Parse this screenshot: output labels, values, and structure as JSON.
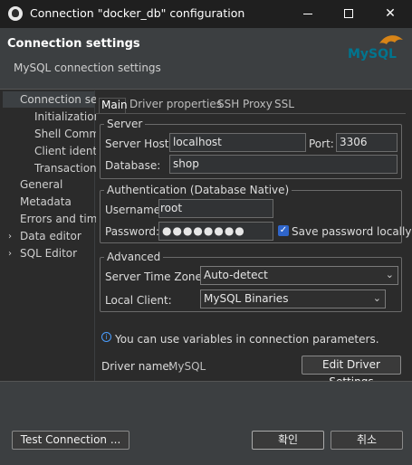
{
  "window": {
    "title": "Connection \"docker_db\" configuration",
    "minimize_glyph": "",
    "close_glyph": "✕"
  },
  "header": {
    "title": "Connection settings",
    "subtitle": "MySQL connection settings",
    "logo_text": "MySQL"
  },
  "tree": {
    "items": [
      {
        "label": "Connection se",
        "level": 0,
        "selected": true
      },
      {
        "label": "Initialization",
        "level": 1
      },
      {
        "label": "Shell Comm",
        "level": 1
      },
      {
        "label": "Client identi",
        "level": 1
      },
      {
        "label": "Transactions",
        "level": 1
      },
      {
        "label": "General",
        "level": 0
      },
      {
        "label": "Metadata",
        "level": 0
      },
      {
        "label": "Errors and time",
        "level": 0
      },
      {
        "label": "Data editor",
        "level": 0,
        "expandable": true
      },
      {
        "label": "SQL Editor",
        "level": 0,
        "expandable": true
      }
    ]
  },
  "tabs": [
    "Main",
    "Driver properties",
    "SSH",
    "Proxy",
    "SSL"
  ],
  "server": {
    "legend": "Server",
    "host_label": "Server Host:",
    "host_value": "localhost",
    "port_label": "Port:",
    "port_value": "3306",
    "database_label": "Database:",
    "database_value": "shop"
  },
  "auth": {
    "legend": "Authentication (Database Native)",
    "username_label": "Username:",
    "username_value": "root",
    "password_label": "Password:",
    "password_mask": "●●●●●●●●",
    "save_password_label": "Save password locally",
    "save_password_checked": true
  },
  "advanced": {
    "legend": "Advanced",
    "timezone_label": "Server Time Zone:",
    "timezone_value": "Auto-detect",
    "client_label": "Local Client:",
    "client_value": "MySQL Binaries"
  },
  "info_text": "You can use variables in connection parameters.",
  "driver": {
    "label": "Driver name:",
    "value": "MySQL",
    "edit_button": "Edit Driver Settings"
  },
  "footer": {
    "test_button": "Test Connection ...",
    "ok_button": "확인",
    "cancel_button": "취소"
  },
  "colors": {
    "accent": "#2f65ca",
    "info": "#4a9eff",
    "logo_blue": "#00758f",
    "logo_orange": "#f29111"
  }
}
